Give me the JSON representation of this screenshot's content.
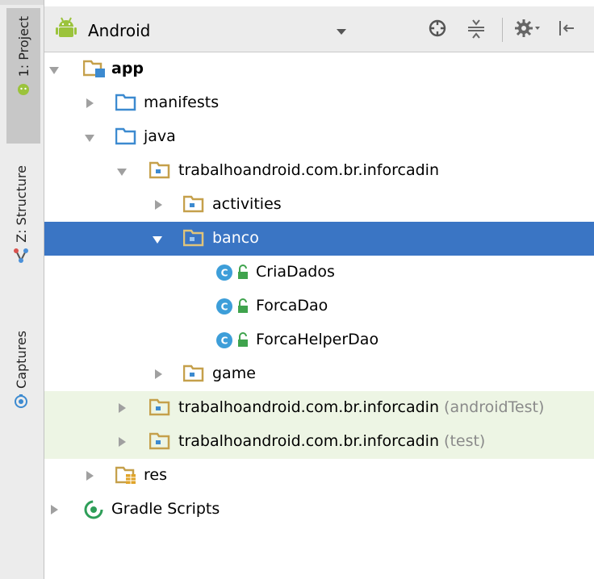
{
  "sidebar": {
    "tabs": [
      {
        "label": "1: Project",
        "icon": "android-icon",
        "active": true
      },
      {
        "label": "Z: Structure",
        "icon": "structure-icon",
        "active": false
      },
      {
        "label": "Captures",
        "icon": "captures-icon",
        "active": false
      }
    ]
  },
  "header": {
    "view_label": "Android",
    "buttons": [
      "sync-icon",
      "collapse-icon",
      "settings-icon",
      "hide-icon"
    ]
  },
  "tree": {
    "app": "app",
    "manifests": "manifests",
    "java": "java",
    "pkg_main": "trabalhoandroid.com.br.inforcadin",
    "activities": "activities",
    "banco": "banco",
    "cria_dados": "CriaDados",
    "forca_dao": "ForcaDao",
    "forca_helper_dao": "ForcaHelperDao",
    "game": "game",
    "pkg_android_test": "trabalhoandroid.com.br.inforcadin",
    "pkg_android_test_suffix": "(androidTest)",
    "pkg_test": "trabalhoandroid.com.br.inforcadin",
    "pkg_test_suffix": "(test)",
    "res": "res",
    "gradle_scripts": "Gradle Scripts"
  },
  "colors": {
    "selection": "#3a75c4",
    "test_bg": "#edf5e4",
    "folder_blue": "#3c8ad0",
    "package_brown": "#c5a04b",
    "class_circle": "#3d9ed9",
    "android_green": "#9bc33b"
  }
}
